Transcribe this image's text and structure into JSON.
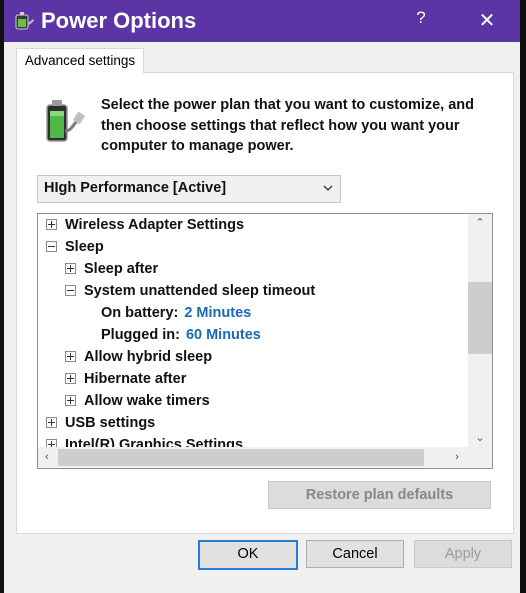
{
  "window": {
    "title": "Power Options",
    "help_label": "?",
    "close_label": "✕"
  },
  "tabs": [
    {
      "label": "Advanced settings",
      "active": true
    }
  ],
  "description": "Select the power plan that you want to customize, and then choose settings that reflect how you want your computer to manage power.",
  "plan_dropdown": {
    "selected": "HIgh Performance [Active]"
  },
  "tree": {
    "items": [
      {
        "label": "Wireless Adapter Settings",
        "state": "collapsed",
        "level": 0
      },
      {
        "label": "Sleep",
        "state": "expanded",
        "level": 0
      },
      {
        "label": "Sleep after",
        "state": "collapsed",
        "level": 1
      },
      {
        "label": "System unattended sleep timeout",
        "state": "expanded",
        "level": 1
      },
      {
        "label": "On battery:",
        "value": "2 Minutes",
        "level": 2
      },
      {
        "label": "Plugged in:",
        "value": "60 Minutes",
        "level": 2
      },
      {
        "label": "Allow hybrid sleep",
        "state": "collapsed",
        "level": 1
      },
      {
        "label": "Hibernate after",
        "state": "collapsed",
        "level": 1
      },
      {
        "label": "Allow wake timers",
        "state": "collapsed",
        "level": 1
      },
      {
        "label": "USB settings",
        "state": "collapsed",
        "level": 0
      },
      {
        "label": "Intel(R) Graphics Settings",
        "state": "collapsed",
        "level": 0
      }
    ]
  },
  "buttons": {
    "restore": "Restore plan defaults",
    "ok": "OK",
    "cancel": "Cancel",
    "apply": "Apply"
  },
  "colors": {
    "titlebar": "#5a35a3",
    "value_link": "#1a6ab3",
    "focus_border": "#2a7bd5"
  },
  "icons": {
    "title": "power-options-icon",
    "plan": "battery-plug-icon"
  }
}
